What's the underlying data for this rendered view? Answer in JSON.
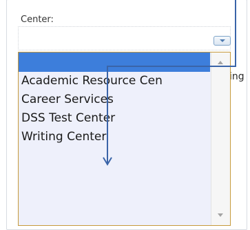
{
  "form": {
    "center_label": "Center:",
    "partial_text": "ing"
  },
  "dropdown": {
    "options": [
      "",
      "Academic Resource Cen",
      "Career Services",
      "DSS Test Center",
      "Writing Center"
    ],
    "selected_index": 0,
    "selected_color": "#3d7edb",
    "border_color": "#c69a3b",
    "list_background": "#eef0fb"
  },
  "annotation": {
    "arrow_color": "#3a64a8"
  },
  "icons": {
    "dropdown_toggle": "chevron-down-icon",
    "scroll_up": "scroll-up-arrow-icon",
    "scroll_down": "scroll-down-arrow-icon",
    "pointer": "annotation-arrow-icon"
  }
}
